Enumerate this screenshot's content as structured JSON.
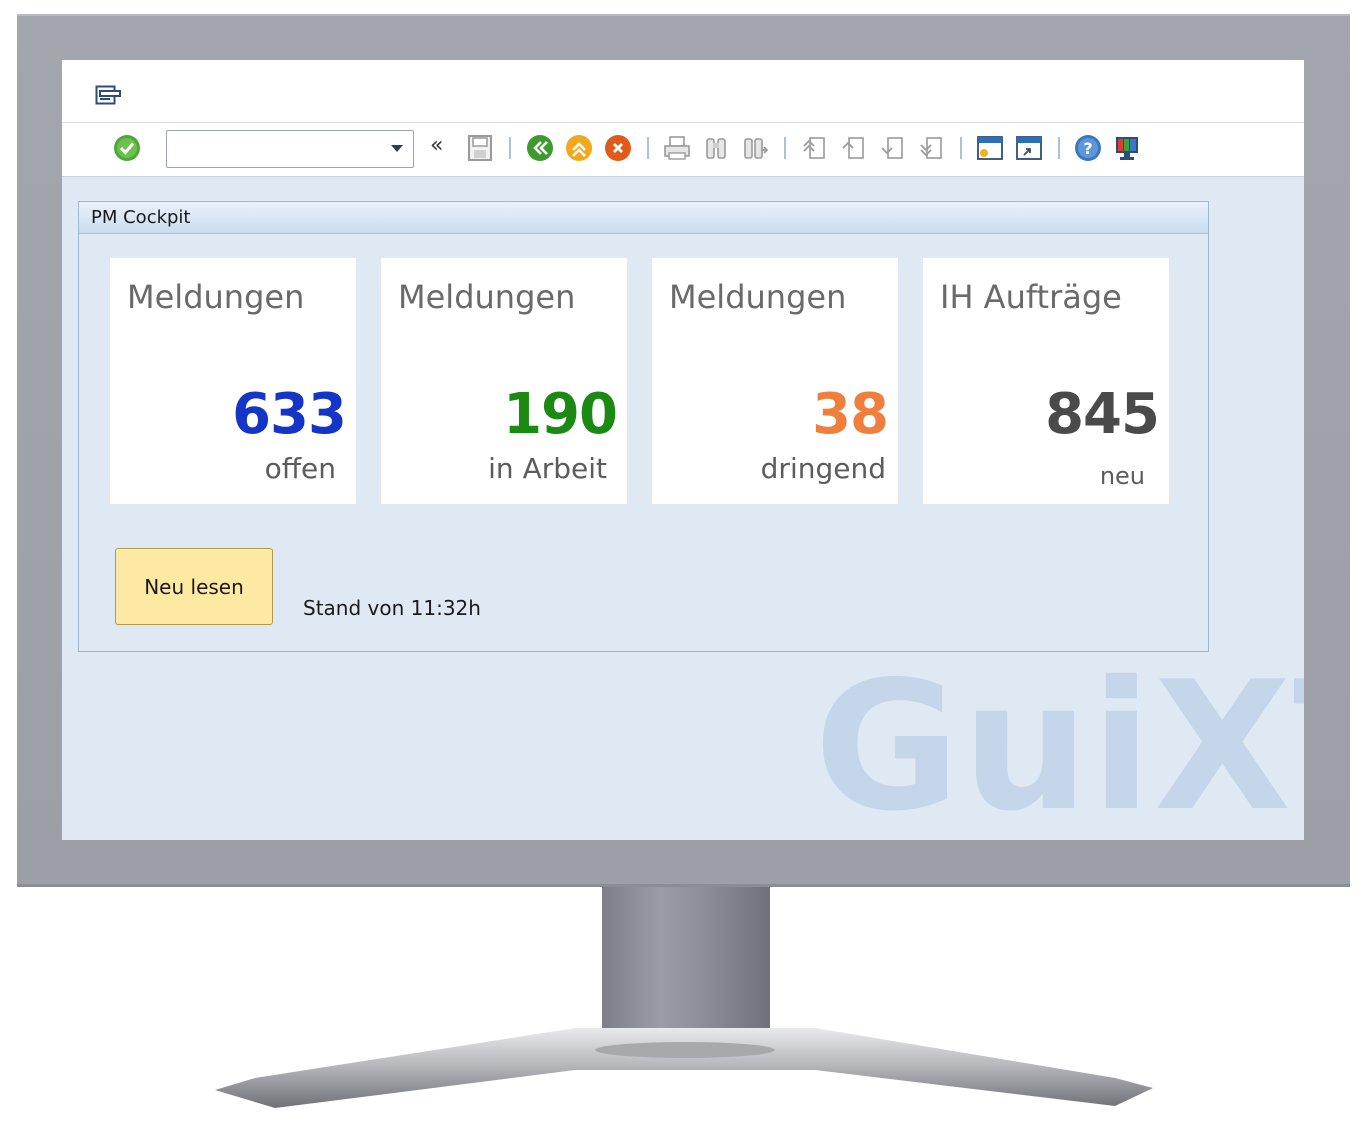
{
  "toolbar": {
    "command_field_value": "",
    "chevron_symbol": "«",
    "icons": [
      "enter-icon",
      "save-icon",
      "back-icon",
      "exit-icon",
      "cancel-icon",
      "print-icon",
      "find-icon",
      "find-next-icon",
      "first-page-icon",
      "previous-page-icon",
      "next-page-icon",
      "last-page-icon",
      "new-session-icon",
      "shortcut-icon",
      "help-icon",
      "layout-icon"
    ]
  },
  "group": {
    "title": "PM Cockpit"
  },
  "tiles": [
    {
      "title": "Meldungen",
      "value": "633",
      "sub": "offen",
      "color": "#1535c6"
    },
    {
      "title": "Meldungen",
      "value": "190",
      "sub": "in Arbeit",
      "color": "#1a8a12"
    },
    {
      "title": "Meldungen",
      "value": "38",
      "sub": "dringend",
      "color": "#f07f3e"
    },
    {
      "title": "IH Aufträge",
      "value": "845",
      "sub": "neu",
      "color": "#4a4a4a"
    }
  ],
  "refresh": {
    "button_label": "Neu lesen",
    "status_text": "Stand von 11:32h"
  },
  "watermark": "GuiXT"
}
